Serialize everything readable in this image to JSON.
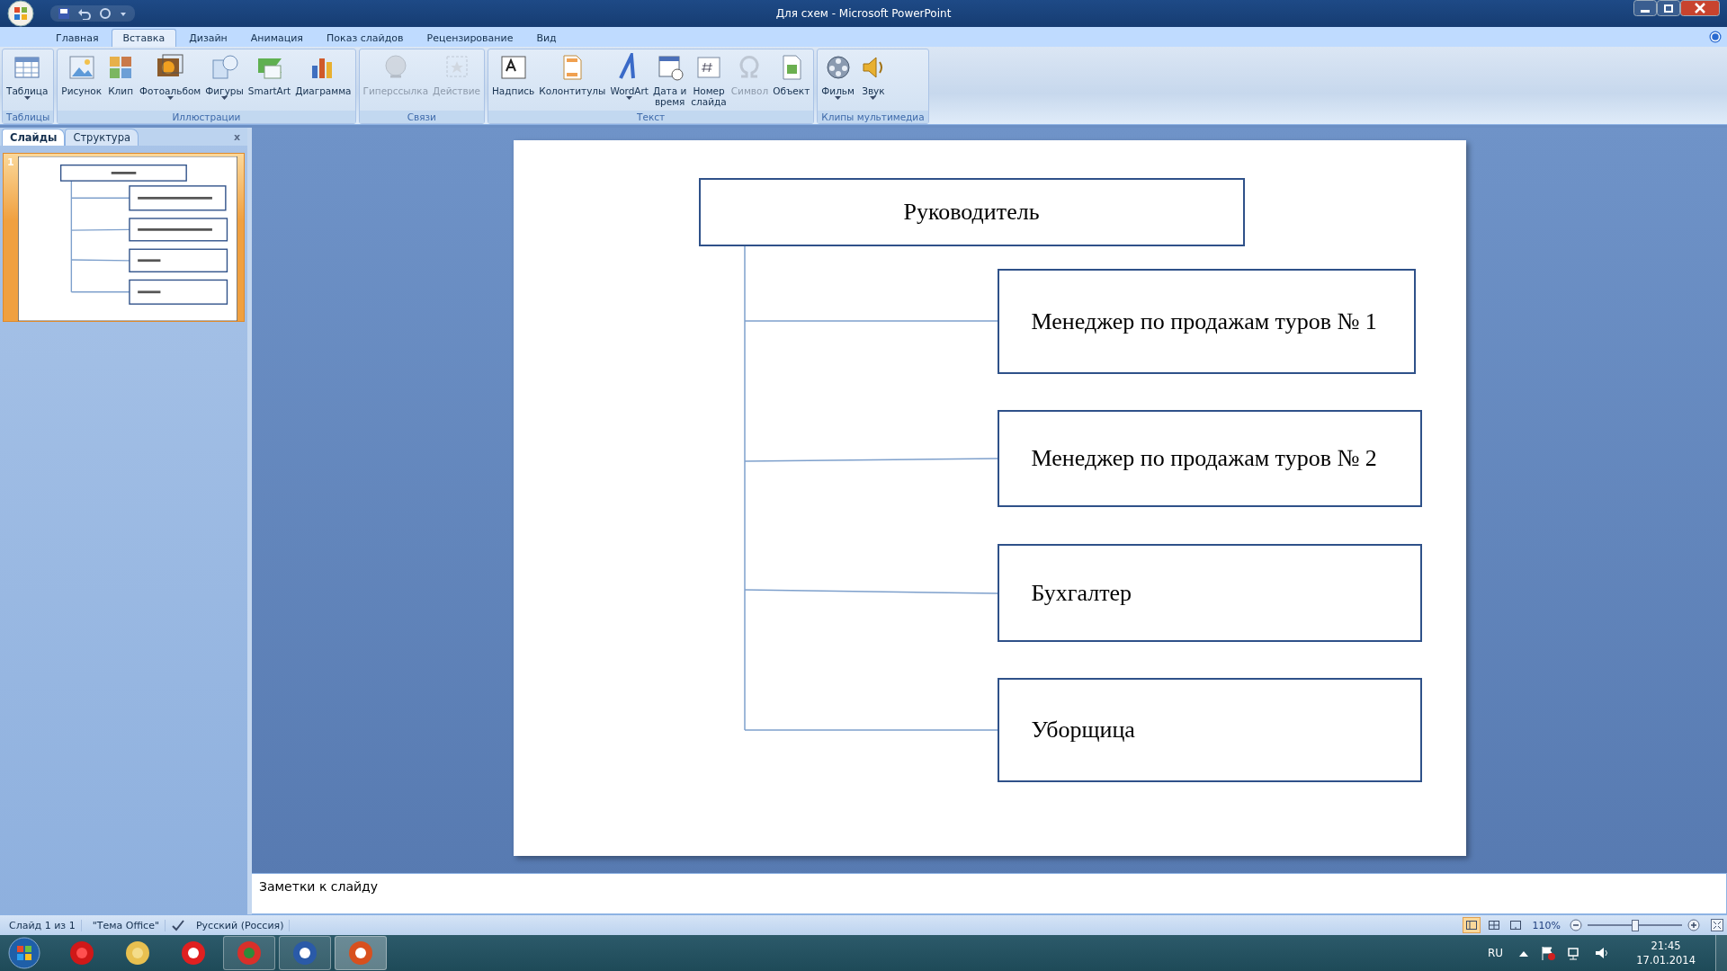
{
  "window": {
    "title": "Для схем - Microsoft PowerPoint"
  },
  "tabs": [
    {
      "label": "Главная",
      "selected": false
    },
    {
      "label": "Вставка",
      "selected": true
    },
    {
      "label": "Дизайн",
      "selected": false
    },
    {
      "label": "Анимация",
      "selected": false
    },
    {
      "label": "Показ слайдов",
      "selected": false
    },
    {
      "label": "Рецензирование",
      "selected": false
    },
    {
      "label": "Вид",
      "selected": false
    }
  ],
  "ribbon_groups": [
    {
      "label": "Таблицы",
      "items": [
        {
          "label": "Таблица",
          "dropdown": true,
          "disabled": false
        }
      ]
    },
    {
      "label": "Иллюстрации",
      "items": [
        {
          "label": "Рисунок",
          "dropdown": false,
          "disabled": false
        },
        {
          "label": "Клип",
          "dropdown": false,
          "disabled": false
        },
        {
          "label": "Фотоальбом",
          "dropdown": true,
          "disabled": false
        },
        {
          "label": "Фигуры",
          "dropdown": true,
          "disabled": false
        },
        {
          "label": "SmartArt",
          "dropdown": false,
          "disabled": false
        },
        {
          "label": "Диаграмма",
          "dropdown": false,
          "disabled": false
        }
      ]
    },
    {
      "label": "Связи",
      "items": [
        {
          "label": "Гиперссылка",
          "dropdown": false,
          "disabled": true
        },
        {
          "label": "Действие",
          "dropdown": false,
          "disabled": true
        }
      ]
    },
    {
      "label": "Текст",
      "items": [
        {
          "label": "Надпись",
          "dropdown": false,
          "disabled": false
        },
        {
          "label": "Колонтитулы",
          "dropdown": false,
          "disabled": false
        },
        {
          "label": "WordArt",
          "dropdown": true,
          "disabled": false
        },
        {
          "label": "Дата и\nвремя",
          "dropdown": false,
          "disabled": false
        },
        {
          "label": "Номер\nслайда",
          "dropdown": false,
          "disabled": false
        },
        {
          "label": "Символ",
          "dropdown": false,
          "disabled": true
        },
        {
          "label": "Объект",
          "dropdown": false,
          "disabled": false
        }
      ]
    },
    {
      "label": "Клипы мультимедиа",
      "items": [
        {
          "label": "Фильм",
          "dropdown": true,
          "disabled": false
        },
        {
          "label": "Звук",
          "dropdown": true,
          "disabled": false
        }
      ]
    }
  ],
  "slide_panel": {
    "tabs": [
      {
        "label": "Слайды",
        "selected": true
      },
      {
        "label": "Структура",
        "selected": false
      }
    ],
    "close": "x",
    "thumbnails": [
      {
        "number": "1",
        "selected": true
      }
    ]
  },
  "slide": {
    "head": "Руководитель",
    "boxes": [
      "Менеджер по продажам туров № 1",
      "Менеджер по продажам туров № 2",
      "Бухгалтер",
      "Уборщица"
    ]
  },
  "notes": {
    "placeholder": "Заметки к слайду"
  },
  "status_bar": {
    "slide": "Слайд 1 из 1",
    "theme": "\"Тема Office\"",
    "language": "Русский (Россия)",
    "views": [
      {
        "selected": true
      },
      {
        "selected": false
      },
      {
        "selected": false
      }
    ],
    "zoom": "110%",
    "zoom_level": {
      "level": 0.5
    }
  },
  "taskbar": {
    "apps": [
      {
        "running": false,
        "selected": false
      },
      {
        "running": false,
        "selected": false
      },
      {
        "running": false,
        "selected": false
      },
      {
        "running": true,
        "selected": false
      },
      {
        "running": true,
        "selected": false
      },
      {
        "running": true,
        "selected": true
      }
    ],
    "language": "RU",
    "time": "21:45",
    "date": "17.01.2014"
  }
}
